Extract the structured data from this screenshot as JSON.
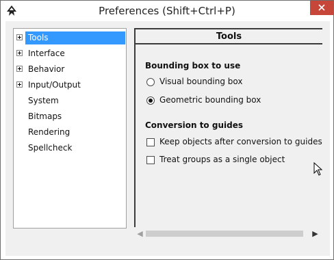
{
  "window": {
    "title": "Preferences (Shift+Ctrl+P)"
  },
  "tree": {
    "items": [
      {
        "label": "Tools",
        "expandable": true,
        "selected": true
      },
      {
        "label": "Interface",
        "expandable": true
      },
      {
        "label": "Behavior",
        "expandable": true
      },
      {
        "label": "Input/Output",
        "expandable": true
      },
      {
        "label": "System",
        "expandable": false
      },
      {
        "label": "Bitmaps",
        "expandable": false
      },
      {
        "label": "Rendering",
        "expandable": false
      },
      {
        "label": "Spellcheck",
        "expandable": false
      }
    ]
  },
  "page": {
    "title": "Tools",
    "bounding_box": {
      "heading": "Bounding box to use",
      "options": [
        {
          "label": "Visual bounding box",
          "selected": false
        },
        {
          "label": "Geometric bounding box",
          "selected": true
        }
      ]
    },
    "conversion": {
      "heading": "Conversion to guides",
      "options": [
        {
          "label": "Keep objects after conversion to guides",
          "checked": false
        },
        {
          "label": "Treat groups as a single object",
          "checked": false
        }
      ]
    }
  },
  "colors": {
    "selection": "#3399ff",
    "close_button": "#c7463a",
    "panel_bg": "#f0f0f0"
  }
}
